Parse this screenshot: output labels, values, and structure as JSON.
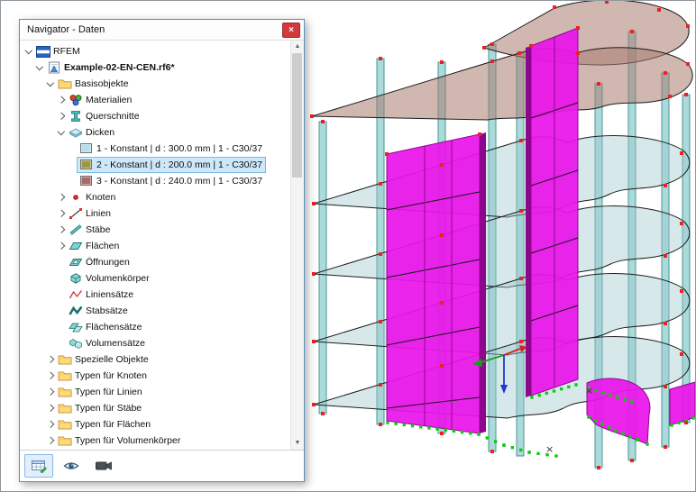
{
  "panel": {
    "title": "Navigator - Daten",
    "close_glyph": "×",
    "scrollbar": {
      "up_glyph": "▲",
      "down_glyph": "▼"
    }
  },
  "tree": {
    "rows": [
      {
        "label": "RFEM",
        "level": 0,
        "chevron": "down",
        "icon": "rfem-logo"
      },
      {
        "label": "Example-02-EN-CEN.rf6*",
        "level": 1,
        "chevron": "down",
        "icon": "model-file",
        "bold": true
      },
      {
        "label": "Basisobjekte",
        "level": 2,
        "chevron": "down",
        "icon": "folder"
      },
      {
        "label": "Materialien",
        "level": 3,
        "chevron": "right",
        "icon": "materials"
      },
      {
        "label": "Querschnitte",
        "level": 3,
        "chevron": "right",
        "icon": "cross-section"
      },
      {
        "label": "Dicken",
        "level": 3,
        "chevron": "down",
        "icon": "thickness"
      },
      {
        "label": "1 - Konstant | d : 300.0 mm | 1 - C30/37",
        "level": 4,
        "chevron": "none",
        "icon": "swatch",
        "swatch": "#b5dfee"
      },
      {
        "label": "2 - Konstant | d : 200.0 mm | 1 - C30/37",
        "level": 4,
        "chevron": "none",
        "icon": "swatch",
        "swatch": "#9b9b3d",
        "selected": true
      },
      {
        "label": "3 - Konstant | d : 240.0 mm | 1 - C30/37",
        "level": 4,
        "chevron": "none",
        "icon": "swatch",
        "swatch": "#aa6a66"
      },
      {
        "label": "Knoten",
        "level": 3,
        "chevron": "right",
        "icon": "node"
      },
      {
        "label": "Linien",
        "level": 3,
        "chevron": "right",
        "icon": "line"
      },
      {
        "label": "Stäbe",
        "level": 3,
        "chevron": "right",
        "icon": "member"
      },
      {
        "label": "Flächen",
        "level": 3,
        "chevron": "right",
        "icon": "surface"
      },
      {
        "label": "Öffnungen",
        "level": 3,
        "chevron": "none",
        "icon": "opening"
      },
      {
        "label": "Volumenkörper",
        "level": 3,
        "chevron": "none",
        "icon": "solid"
      },
      {
        "label": "Liniensätze",
        "level": 3,
        "chevron": "none",
        "icon": "line-set"
      },
      {
        "label": "Stabsätze",
        "level": 3,
        "chevron": "none",
        "icon": "member-set"
      },
      {
        "label": "Flächensätze",
        "level": 3,
        "chevron": "none",
        "icon": "surface-set"
      },
      {
        "label": "Volumensätze",
        "level": 3,
        "chevron": "none",
        "icon": "solid-set"
      },
      {
        "label": "Spezielle Objekte",
        "level": 2,
        "chevron": "right",
        "icon": "folder"
      },
      {
        "label": "Typen für Knoten",
        "level": 2,
        "chevron": "right",
        "icon": "folder"
      },
      {
        "label": "Typen für Linien",
        "level": 2,
        "chevron": "right",
        "icon": "folder"
      },
      {
        "label": "Typen für Stäbe",
        "level": 2,
        "chevron": "right",
        "icon": "folder"
      },
      {
        "label": "Typen für Flächen",
        "level": 2,
        "chevron": "right",
        "icon": "folder"
      },
      {
        "label": "Typen für Volumenkörper",
        "level": 2,
        "chevron": "right",
        "icon": "folder"
      }
    ]
  },
  "toolbar": {
    "tabs": [
      {
        "id": "data",
        "icon": "data-table-icon",
        "active": true
      },
      {
        "id": "display",
        "icon": "eye-icon",
        "active": false
      },
      {
        "id": "views",
        "icon": "camera-icon",
        "active": false
      }
    ]
  },
  "viewport": {
    "xmark_glyph": "×",
    "colors": {
      "wall": "#ea14ea",
      "wall_dark": "#8d078d",
      "slab": "#9fc9cf",
      "slab_top": "#a97b70",
      "column": "#aadada",
      "column_edge": "#4b9494",
      "node": "#ee2020",
      "selection": "#0acc0a",
      "axis_x": "#d42222",
      "axis_y": "#18a018",
      "axis_z": "#2238d4",
      "selection_bg": "#cde8fa",
      "selection_border": "#7cb9e8",
      "close_button": "#d23a3e"
    }
  }
}
